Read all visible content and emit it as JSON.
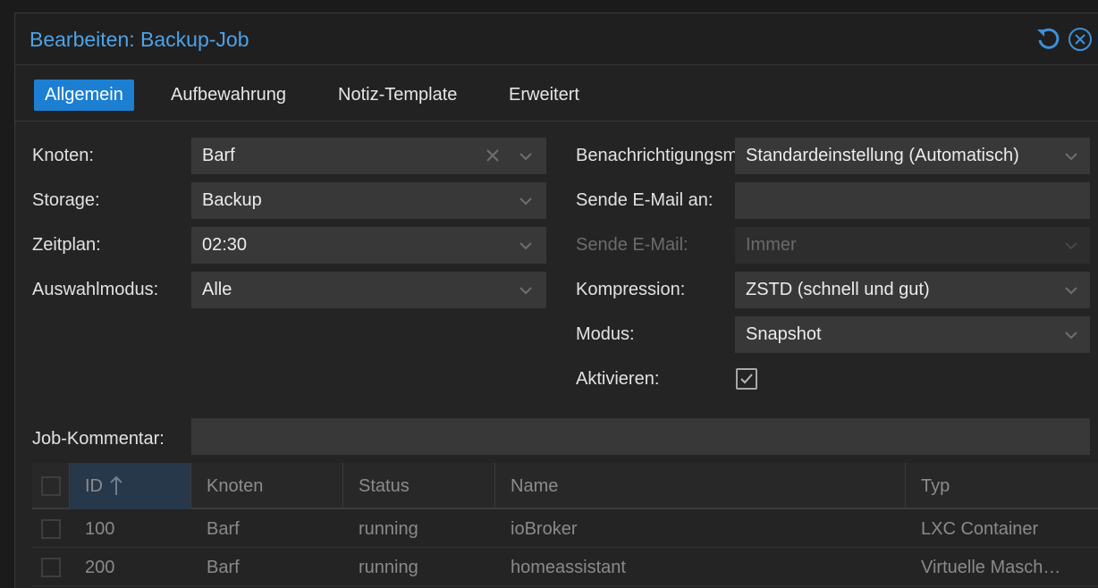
{
  "dialog": {
    "title": "Bearbeiten: Backup-Job"
  },
  "tabs": [
    {
      "label": "Allgemein",
      "active": true
    },
    {
      "label": "Aufbewahrung",
      "active": false
    },
    {
      "label": "Notiz-Template",
      "active": false
    },
    {
      "label": "Erweitert",
      "active": false
    }
  ],
  "form": {
    "left": {
      "node": {
        "label": "Knoten:",
        "value": "Barf"
      },
      "storage": {
        "label": "Storage:",
        "value": "Backup"
      },
      "schedule": {
        "label": "Zeitplan:",
        "value": "02:30"
      },
      "selection": {
        "label": "Auswahlmodus:",
        "value": "Alle"
      }
    },
    "right": {
      "notification": {
        "label": "Benachrichtigungsmodus:",
        "value": "Standardeinstellung (Automatisch)"
      },
      "mailto": {
        "label": "Sende E-Mail an:",
        "value": ""
      },
      "mailwhen": {
        "label": "Sende E-Mail:",
        "value": "Immer",
        "disabled": true
      },
      "compression": {
        "label": "Kompression:",
        "value": "ZSTD (schnell und gut)"
      },
      "mode": {
        "label": "Modus:",
        "value": "Snapshot"
      },
      "enable": {
        "label": "Aktivieren:",
        "checked": true
      }
    },
    "comment": {
      "label": "Job-Kommentar:",
      "value": ""
    }
  },
  "grid": {
    "columns": [
      "ID",
      "Knoten",
      "Status",
      "Name",
      "Typ"
    ],
    "sorted_column": "ID",
    "sort_direction": "ascending",
    "rows": [
      {
        "id": "100",
        "node": "Barf",
        "status": "running",
        "name": "ioBroker",
        "type": "LXC Container"
      },
      {
        "id": "200",
        "node": "Barf",
        "status": "running",
        "name": "homeassistant",
        "type": "Virtuelle Maschine"
      }
    ]
  },
  "icons": {
    "reset": "undo-icon",
    "close": "close-circle-icon",
    "clear": "clear-x-icon",
    "dropdown": "chevron-down-icon",
    "sort": "arrow-up-icon",
    "check": "checkmark-icon"
  },
  "colors": {
    "accent": "#1c7fd1",
    "title": "#4ea2e6",
    "background": "#242424",
    "field": "#383838"
  }
}
